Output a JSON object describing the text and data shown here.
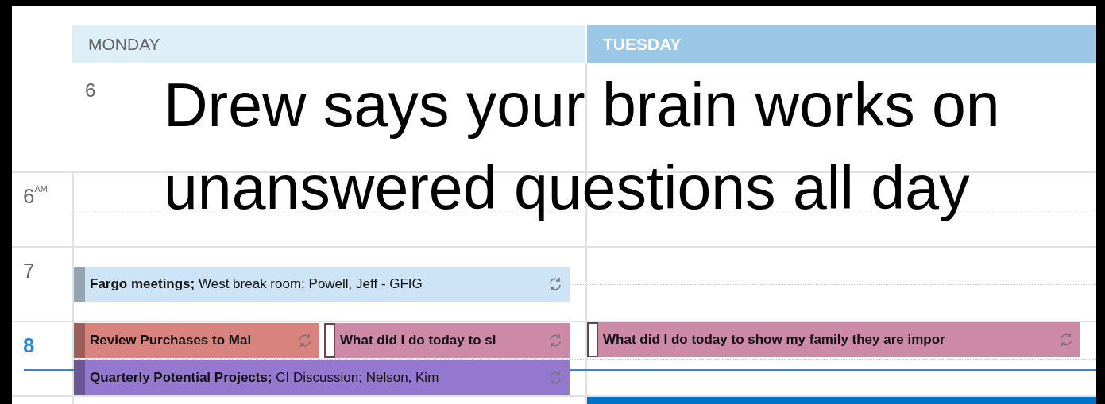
{
  "calendar": {
    "days": [
      {
        "name": "MONDAY",
        "date": "6",
        "selected": false
      },
      {
        "name": "TUESDAY",
        "selected": true
      }
    ],
    "hours": [
      {
        "label": "6",
        "suffix": "AM"
      },
      {
        "label": "7",
        "cells": [
          {
            "lines": [
              [
                {
                  "kind": "event",
                  "text": "**Fargo meetings;** West break room; Powell, Jeff - GFIG",
                  "color": "#cde4f6",
                  "tentative": false,
                  "recurring": true
                }
              ]
            ]
          }
        ]
      },
      {
        "label": "8",
        "current": true,
        "cells": [
          {
            "lines": [
              [
                {
                  "kind": "event",
                  "text": "Review Purchases to Mal",
                  "bold": true,
                  "color": "#d9837f",
                  "tentative": false,
                  "recurring": true
                },
                {
                  "kind": "event",
                  "text": "What did I do today to sl",
                  "bold": true,
                  "color": "#cd8aa6",
                  "tentative": true,
                  "recurring": true
                }
              ],
              [
                {
                  "kind": "event",
                  "text": "**Quarterly Potential Projects;** CI Discussion; Nelson, Kim",
                  "color": "#9478d0",
                  "tentative": false,
                  "recurring": true
                }
              ]
            ]
          },
          {
            "lines": [
              [
                {
                  "kind": "event",
                  "text": "What did I do today to show my family they are impor",
                  "bold": true,
                  "color": "#cd8aa6",
                  "tentative": true,
                  "recurring": true
                }
              ]
            ]
          }
        ]
      },
      {
        "cells": [
          {},
          {
            "lines": [
              [
                {
                  "kind": "block",
                  "color": "#0072c6"
                }
              ]
            ]
          }
        ]
      }
    ]
  },
  "caption": {
    "lines": [
      "Drew says your brain works on",
      "unanswered questions all day"
    ]
  }
}
